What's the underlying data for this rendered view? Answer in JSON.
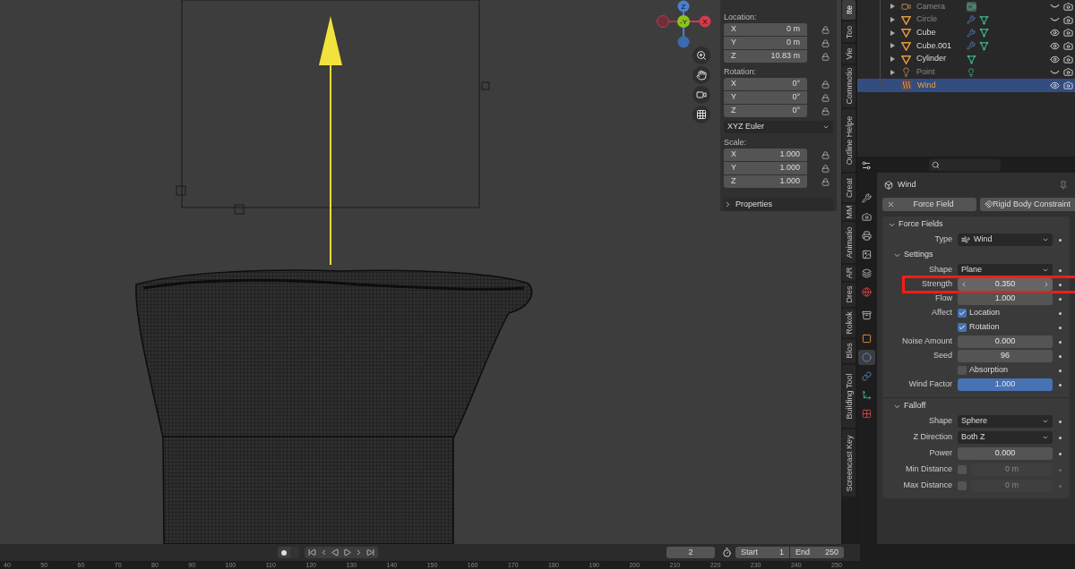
{
  "viewport": {
    "gizmo": {
      "labels": [
        "Z",
        "-Y",
        "X"
      ]
    },
    "sidebar": {
      "sections": [
        {
          "title": "Location:",
          "rows": [
            {
              "axis": "X",
              "value": "0 m"
            },
            {
              "axis": "Y",
              "value": "0 m"
            },
            {
              "axis": "Z",
              "value": "10.83 m"
            }
          ]
        },
        {
          "title": "Rotation:",
          "rows": [
            {
              "axis": "X",
              "value": "0°"
            },
            {
              "axis": "Y",
              "value": "0°"
            },
            {
              "axis": "Z",
              "value": "0°"
            }
          ],
          "mode": "XYZ Euler"
        },
        {
          "title": "Scale:",
          "rows": [
            {
              "axis": "X",
              "value": "1.000"
            },
            {
              "axis": "Y",
              "value": "1.000"
            },
            {
              "axis": "Z",
              "value": "1.000"
            }
          ]
        }
      ],
      "subpanel": {
        "title": "Properties",
        "expanded": false
      }
    }
  },
  "sidebar_tabs": [
    {
      "label": "Ite",
      "selected": true
    },
    {
      "label": "Too",
      "selected": false
    },
    {
      "label": "Vie",
      "selected": false
    },
    {
      "label": "Commotio",
      "selected": false
    },
    {
      "label": "Outline Helpe",
      "selected": false
    },
    {
      "label": "Creat",
      "selected": false
    },
    {
      "label": "MM",
      "selected": false
    },
    {
      "label": "Animatio",
      "selected": false
    },
    {
      "label": "AR",
      "selected": false
    },
    {
      "label": "Dres",
      "selected": false
    },
    {
      "label": "Rokok",
      "selected": false
    },
    {
      "label": "Blos",
      "selected": false
    },
    {
      "label": "Building Tool",
      "selected": false
    },
    {
      "label": "Screencast Key",
      "selected": false
    }
  ],
  "outliner": {
    "items": [
      {
        "name": "Camera",
        "kind": "camera",
        "visible": false,
        "selected": false,
        "modifier": false
      },
      {
        "name": "Circle",
        "kind": "mesh",
        "visible": false,
        "selected": false,
        "modifier": true
      },
      {
        "name": "Cube",
        "kind": "mesh",
        "visible": true,
        "selected": false,
        "modifier": true
      },
      {
        "name": "Cube.001",
        "kind": "mesh",
        "visible": true,
        "selected": false,
        "modifier": true
      },
      {
        "name": "Cylinder",
        "kind": "mesh",
        "visible": true,
        "selected": false,
        "modifier": false
      },
      {
        "name": "Point",
        "kind": "light",
        "visible": false,
        "selected": false,
        "modifier": false
      },
      {
        "name": "Wind",
        "kind": "field",
        "visible": true,
        "selected": true,
        "modifier": false
      }
    ]
  },
  "properties": {
    "tabs": [
      {
        "kind": "tool",
        "selected": false
      },
      {
        "kind": "render",
        "selected": false
      },
      {
        "kind": "output",
        "selected": false
      },
      {
        "kind": "view-layer",
        "selected": false
      },
      {
        "kind": "scene",
        "selected": false
      },
      {
        "kind": "world",
        "selected": false
      },
      {
        "kind": "collection",
        "selected": false
      },
      {
        "kind": "object",
        "selected": false
      },
      {
        "kind": "physics",
        "selected": true
      },
      {
        "kind": "constraints",
        "selected": false
      },
      {
        "kind": "data",
        "selected": false
      },
      {
        "kind": "texture",
        "selected": false
      }
    ],
    "object_name": "Wind",
    "buttons": [
      {
        "label": "Force Field",
        "kind": "remove"
      },
      {
        "label": "Rigid Body Constraint",
        "kind": "add"
      }
    ],
    "panel": {
      "title": "Force Fields",
      "expanded": true,
      "rows": [
        {
          "kind": "dropdown",
          "label": "Type",
          "value": "Wind",
          "icon": true,
          "highlighted": false
        }
      ],
      "subpanels": [
        {
          "title": "Settings",
          "expanded": true,
          "rows": [
            {
              "kind": "dropdown",
              "label": "Shape",
              "value": "Plane",
              "icon": false,
              "highlighted": false
            },
            {
              "kind": "number",
              "label": "Strength",
              "value": "0.350",
              "active": false,
              "highlighted": true
            },
            {
              "kind": "number",
              "label": "Flow",
              "value": "1.000",
              "active": false,
              "highlighted": false
            },
            {
              "kind": "checkbox",
              "label": "Affect",
              "text": "Location",
              "checked": true,
              "highlighted": false
            },
            {
              "kind": "checkbox",
              "text": "Rotation",
              "checked": true,
              "highlighted": false
            },
            {
              "kind": "number",
              "label": "Noise Amount",
              "value": "0.000",
              "active": false,
              "highlighted": false
            },
            {
              "kind": "number",
              "label": "Seed",
              "value": "96",
              "active": false,
              "highlighted": false
            },
            {
              "kind": "checkbox",
              "text": "Absorption",
              "checked": false,
              "highlighted": false
            },
            {
              "kind": "number",
              "label": "Wind Factor",
              "value": "1.000",
              "active": true,
              "highlighted": false
            }
          ]
        },
        {
          "title": "Falloff",
          "expanded": true,
          "rows": [
            {
              "kind": "dropdown",
              "label": "Shape",
              "value": "Sphere",
              "icon": false,
              "highlighted": false
            },
            {
              "kind": "dropdown",
              "label": "Z Direction",
              "value": "Both Z",
              "icon": false,
              "highlighted": false
            },
            {
              "kind": "number",
              "label": "Power",
              "value": "0.000",
              "active": false,
              "highlighted": false
            },
            {
              "kind": "toggle-number",
              "label": "Min Distance",
              "value": "0 m",
              "checked": false,
              "highlighted": false
            },
            {
              "kind": "toggle-number",
              "label": "Max Distance",
              "value": "0 m",
              "checked": false,
              "highlighted": false
            }
          ]
        }
      ]
    }
  },
  "timeline": {
    "current_frame": "2",
    "start_label": "Start",
    "start": "1",
    "end_label": "End",
    "end": "250",
    "ruler": [
      "40",
      "50",
      "60",
      "70",
      "80",
      "90",
      "100",
      "110",
      "120",
      "130",
      "140",
      "150",
      "160",
      "170",
      "180",
      "190",
      "200",
      "210",
      "220",
      "230",
      "240",
      "250"
    ]
  }
}
